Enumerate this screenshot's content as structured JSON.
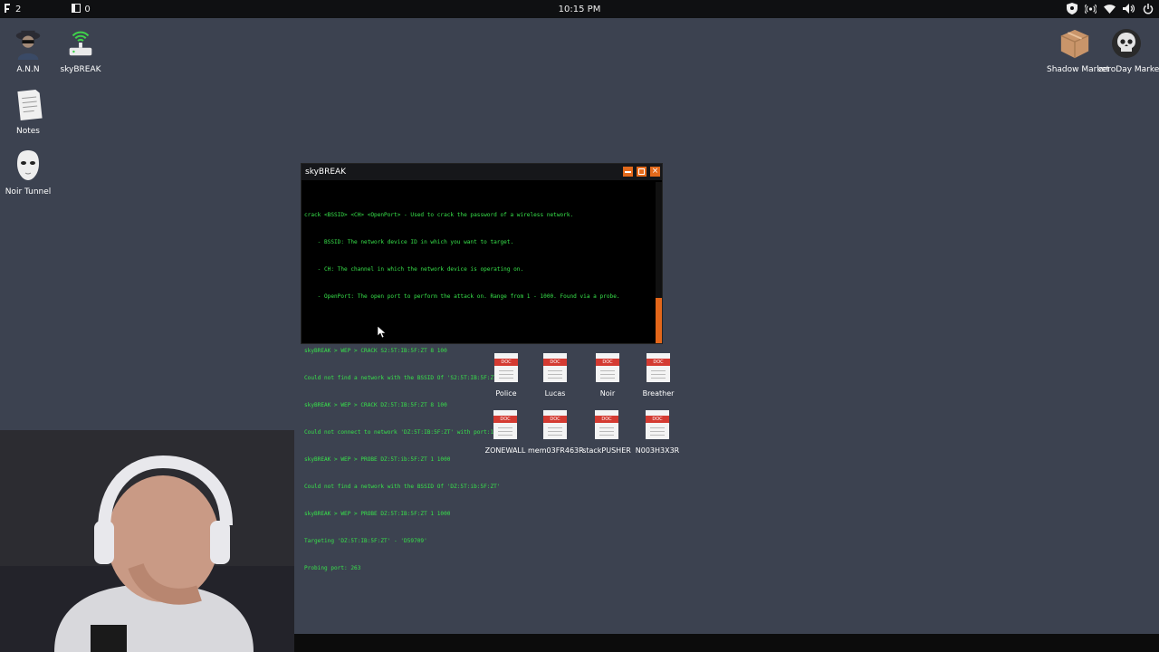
{
  "topbar": {
    "workspace_count": "2",
    "window_count": "0",
    "clock": "10:15 PM"
  },
  "desktop_icons": [
    {
      "label": "A.N.N",
      "icon": "hacker-avatar-icon"
    },
    {
      "label": "skyBREAK",
      "icon": "wifi-router-icon"
    },
    {
      "label": "Notes",
      "icon": "notes-icon"
    },
    {
      "label": "Noir Tunnel",
      "icon": "mask-icon"
    },
    {
      "label": "Shadow Market",
      "icon": "package-box-icon"
    },
    {
      "label": "zeroDay Market",
      "icon": "skull-icon"
    }
  ],
  "window": {
    "title": "skyBREAK",
    "lines": [
      "crack <BSSID> <CH> <OpenPort> - Used to crack the password of a wireless network.",
      "    - BSSID: The network device ID in which you want to target.",
      "    - CH: The channel in which the network device is operating on.",
      "    - OpenPort: The open port to perform the attack on. Range from 1 - 1000. Found via a probe.",
      "",
      "skyBREAK > WEP > CRACK S2:5T:IB:5F:ZT 8 100",
      "Could not find a network with the BSSID Of 'S2:5T:IB:5F:ZT'",
      "skyBREAK > WEP > CRACK DZ:5T:IB:5F:ZT 8 100",
      "Could not connect to network 'DZ:5T:IB:5F:ZT' with port:100",
      "skyBREAK > WEP > PROBE DZ:5T:ib:5F:ZT 1 1000",
      "Could not find a network with the BSSID Of 'DZ:5T:ib:5F:ZT'",
      "skyBREAK > WEP > PROBE DZ:5T:IB:5F:ZT 1 1000",
      "Targeting 'DZ:5T:IB:5F:ZT' - 'D59709'",
      "Probing port: 263"
    ]
  },
  "docs": [
    {
      "label": "Police",
      "tag": "DOC"
    },
    {
      "label": "Lucas",
      "tag": "DOC"
    },
    {
      "label": "Noir",
      "tag": "DOC"
    },
    {
      "label": "Breather",
      "tag": "DOC"
    },
    {
      "label": "ZONEWALL",
      "tag": "DOC"
    },
    {
      "label": "mem03FR463R",
      "tag": "DOC"
    },
    {
      "label": "stackPUSHER",
      "tag": "DOC"
    },
    {
      "label": "N003H3X3R",
      "tag": "DOC"
    }
  ],
  "colors": {
    "desktop_bg": "#3c4250",
    "terminal_text": "#37e24a",
    "accent": "#e3661a",
    "doc_tag": "#d43b32"
  }
}
